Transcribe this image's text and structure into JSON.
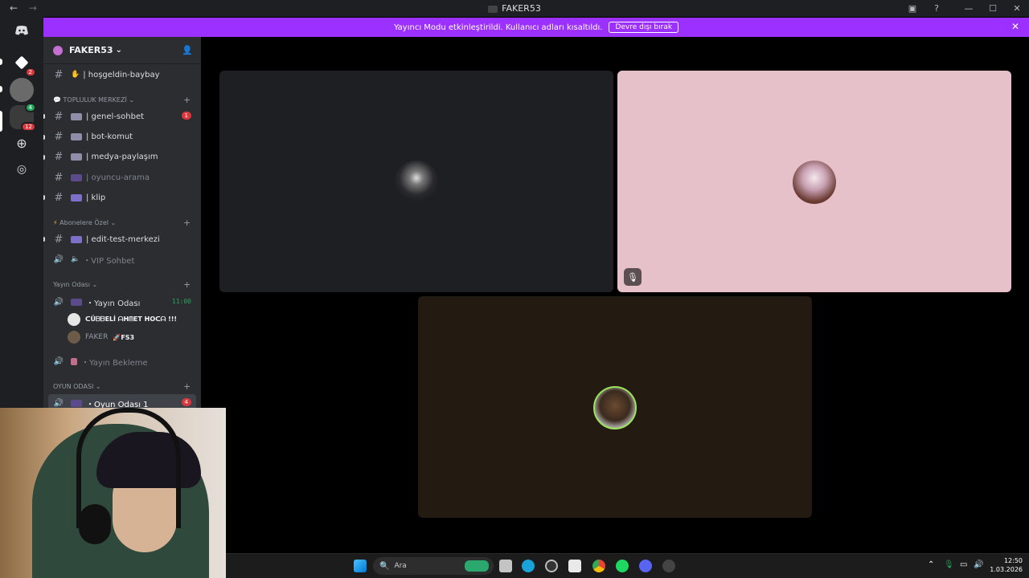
{
  "window": {
    "title": "FAKER53",
    "back": "←",
    "forward": "→",
    "controls": [
      "▣",
      "?",
      "—",
      "☐",
      "✕"
    ]
  },
  "banner": {
    "message": "Yayıncı Modu etkinleştirildi. Kullanıcı adları kısaltıldı.",
    "button": "Devre dışı bırak",
    "close": "✕"
  },
  "rail": {
    "badges": [
      "2",
      "4",
      "12"
    ]
  },
  "server": {
    "name": "FAKER53",
    "chevron": "⌄"
  },
  "channels": {
    "welcome": "| hoşgeldin-baybay",
    "cat_community": "TOPLULUK MERKEZİ",
    "genel": "| genel-sohbet",
    "genel_count": "1",
    "bot": "| bot-komut",
    "medya": "| medya-paylaşım",
    "oyuncu": "| oyuncu-arama",
    "klip": "| klip",
    "cat_sub": "Abonelere Özel",
    "edit": "| edit-test-merkezi",
    "vip": "・VIP Sohbet",
    "cat_stream": "Yayın Odası",
    "yayin": "・Yayın Odası",
    "yayin_time": "11:00",
    "member1": "ᑕÜᗷᗷEᒪİ ᗩᕼᗰET ᕼOᑕᗩ !!!",
    "member2": "FAKER",
    "member2_tag": "FS3",
    "bekleme": "・Yayın Bekleme",
    "cat_game": "OYUN ODASI",
    "oyun1": "・Oyun Odası 1",
    "oyun1_count": "4"
  },
  "taskbar": {
    "search": "Ara",
    "time": "12:50",
    "date": "1.03.2026"
  },
  "colors": {
    "banner": "#9b30ff",
    "sidebar": "#2b2d31",
    "rail": "#1e1f22",
    "tile_pink": "#e7c1c9",
    "tile_dark": "#1e1f22",
    "tile_brown": "#231a12"
  }
}
